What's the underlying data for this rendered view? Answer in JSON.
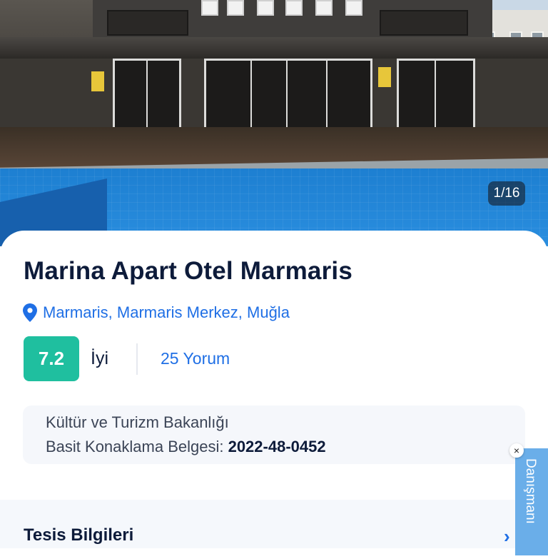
{
  "gallery": {
    "counter": "1/16"
  },
  "hotel": {
    "name": "Marina Apart Otel Marmaris",
    "location": "Marmaris, Marmaris Merkez, Muğla",
    "score": "7.2",
    "score_label": "İyi",
    "reviews": "25 Yorum"
  },
  "license": {
    "line1": "Kültür ve Turizm Bakanlığı",
    "line2_prefix": "Basit Konaklama Belgesi: ",
    "number": "2022-48-0452"
  },
  "sections": {
    "facility_info": "Tesis Bilgileri",
    "chevron": "›"
  },
  "advisor": {
    "label": "Danışmanı",
    "close": "×"
  },
  "colors": {
    "accent": "#1f6fe5",
    "score_bg": "#1fbf9f",
    "title": "#0d1b3a"
  }
}
